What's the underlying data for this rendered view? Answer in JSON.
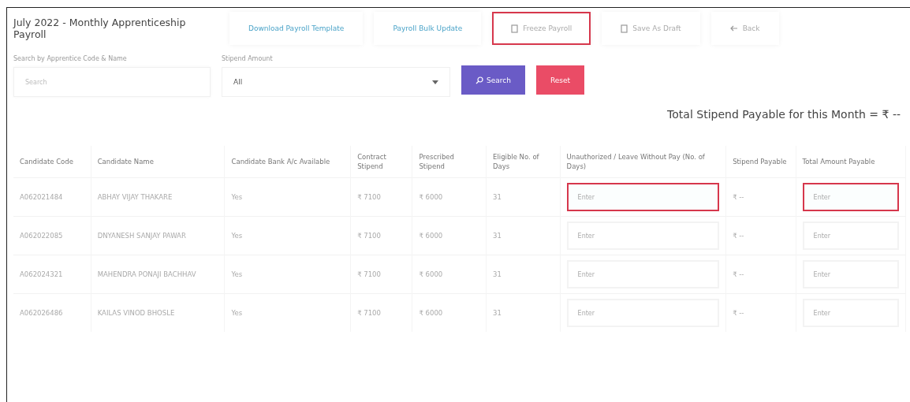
{
  "header": {
    "title": "July 2022 - Monthly Apprenticeship Payroll",
    "actions": [
      {
        "kind": "link",
        "label": "Download Payroll Template",
        "highlighted": false
      },
      {
        "kind": "link",
        "label": "Payroll Bulk Update",
        "highlighted": false
      },
      {
        "kind": "doc",
        "label": "Freeze Payroll",
        "highlighted": true
      },
      {
        "kind": "doc",
        "label": "Save As Draft",
        "highlighted": false
      },
      {
        "kind": "back",
        "label": "Back",
        "highlighted": false
      }
    ]
  },
  "filters": {
    "search": {
      "label": "Search by Apprentice Code & Name",
      "placeholder": "Search"
    },
    "stipend": {
      "label": "Stipend Amount",
      "value": "All"
    },
    "buttons": [
      {
        "kind": "search",
        "label": "Search"
      },
      {
        "kind": "reset",
        "label": "Reset"
      }
    ]
  },
  "total": "Total Stipend Payable for this Month = ₹ --",
  "table": {
    "columns": [
      "Candidate Code",
      "Candidate Name",
      "Candidate Bank A/c Available",
      "Contract Stipend",
      "Prescribed Stipend",
      "Eligible No. of Days",
      "Unauthorized / Leave Without Pay (No. of Days)",
      "Stipend Payable",
      "Total Amount Payable"
    ],
    "rows": [
      {
        "code": "A062021484",
        "name": "ABHAY VIJAY THAKARE",
        "bank": "Yes",
        "contract": "₹ 7100",
        "prescribed": "₹ 6000",
        "days": "31",
        "leave": {
          "placeholder": "Enter",
          "highlighted": true
        },
        "payable": "₹ --",
        "total": {
          "placeholder": "Enter",
          "highlighted": true
        }
      },
      {
        "code": "A062022085",
        "name": "DNYANESH SANJAY PAWAR",
        "bank": "Yes",
        "contract": "₹ 7100",
        "prescribed": "₹ 6000",
        "days": "31",
        "leave": {
          "placeholder": "Enter",
          "highlighted": false
        },
        "payable": "₹ --",
        "total": {
          "placeholder": "Enter",
          "highlighted": false
        }
      },
      {
        "code": "A062024321",
        "name": "MAHENDRA PONAJI BACHHAV",
        "bank": "Yes",
        "contract": "₹ 7100",
        "prescribed": "₹ 6000",
        "days": "31",
        "leave": {
          "placeholder": "Enter",
          "highlighted": false
        },
        "payable": "₹ --",
        "total": {
          "placeholder": "Enter",
          "highlighted": false
        }
      },
      {
        "code": "A062026486",
        "name": "KAILAS VINOD BHOSLE",
        "bank": "Yes",
        "contract": "₹ 7100",
        "prescribed": "₹ 6000",
        "days": "31",
        "leave": {
          "placeholder": "Enter",
          "highlighted": false
        },
        "payable": "₹ --",
        "total": {
          "placeholder": "Enter",
          "highlighted": false
        }
      }
    ]
  }
}
